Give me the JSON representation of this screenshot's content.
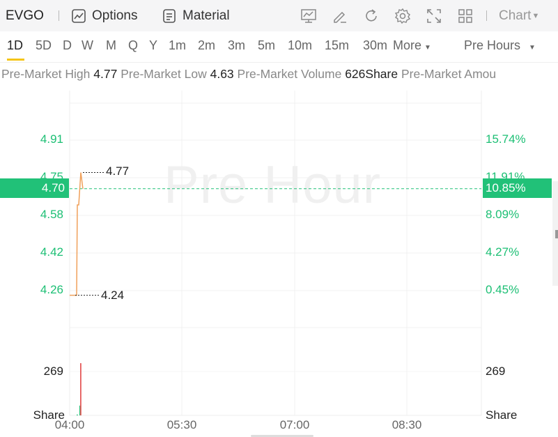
{
  "toolbar": {
    "symbol": "EVGO",
    "options_label": "Options",
    "material_label": "Material",
    "chart_label": "Chart"
  },
  "tabs": [
    {
      "label": "1D",
      "active": true
    },
    {
      "label": "5D"
    },
    {
      "label": "D"
    },
    {
      "label": "W"
    },
    {
      "label": "M"
    },
    {
      "label": "Q"
    },
    {
      "label": "Y"
    },
    {
      "label": "1m"
    },
    {
      "label": "2m"
    },
    {
      "label": "3m"
    },
    {
      "label": "5m"
    },
    {
      "label": "10m"
    },
    {
      "label": "15m"
    },
    {
      "label": "30m"
    },
    {
      "label": "More"
    }
  ],
  "session_select": "Pre Hours",
  "info": {
    "high_label": "Pre-Market High",
    "high_value": "4.77",
    "low_label": "Pre-Market Low",
    "low_value": "4.63",
    "volume_label": "Pre-Market Volume",
    "volume_value": "626Share",
    "amount_label": "Pre-Market Amou"
  },
  "watermark": "Pre Hour",
  "current": {
    "price": "4.70",
    "pct": "10.85%"
  },
  "colors": {
    "up": "#1cbf74",
    "price_line": "#f0a05a",
    "down_bar": "#e55a5a",
    "accent": "#f5c518"
  },
  "chart_data": {
    "type": "line",
    "price_axis_left": [
      "4.91",
      "4.75",
      "4.58",
      "4.42",
      "4.26"
    ],
    "price_axis_right": [
      "15.74%",
      "11.91%",
      "8.09%",
      "4.27%",
      "0.45%"
    ],
    "volume_axis_left": [
      "269",
      "Share"
    ],
    "volume_axis_right": [
      "269",
      "Share"
    ],
    "x_ticks": [
      "04:00",
      "05:30",
      "07:00",
      "08:30"
    ],
    "high_label": "4.77",
    "low_label": "4.24",
    "price": [
      {
        "t": 0.0,
        "v": 4.24
      },
      {
        "t": 0.09,
        "v": 4.24
      },
      {
        "t": 0.1,
        "v": 4.24
      },
      {
        "t": 0.11,
        "v": 4.63
      },
      {
        "t": 0.13,
        "v": 4.63
      },
      {
        "t": 0.16,
        "v": 4.77
      },
      {
        "t": 0.19,
        "v": 4.7
      }
    ],
    "volume": [
      {
        "t": 0.1,
        "v": 5,
        "dir": "up"
      },
      {
        "t": 0.14,
        "v": 60,
        "dir": "up"
      },
      {
        "t": 0.15,
        "v": 320,
        "dir": "down"
      }
    ]
  }
}
